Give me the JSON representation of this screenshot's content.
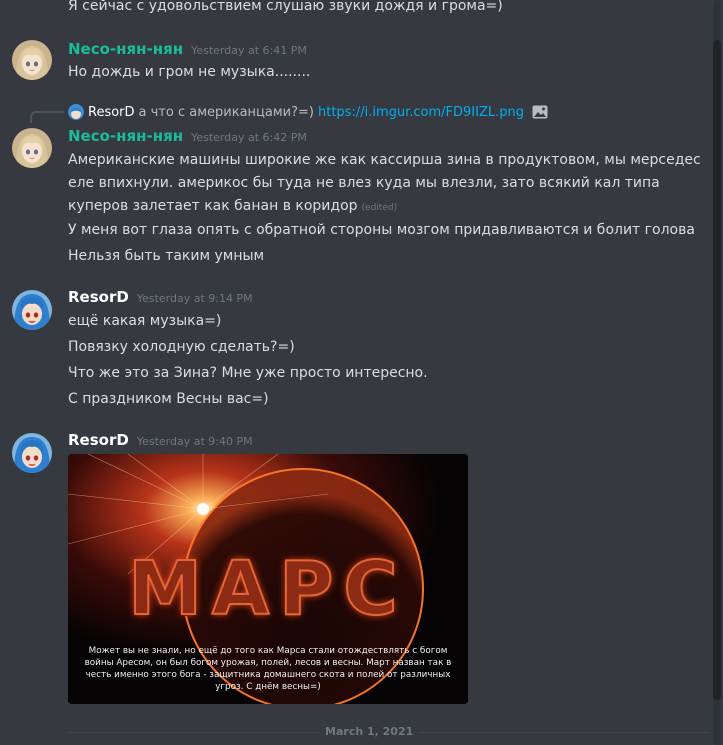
{
  "messages": {
    "m0": {
      "lines": [
        "Я сейчас с удовольствием слушаю звуки дождя и грома=)"
      ]
    },
    "m1": {
      "username": "Neco-нян-нян",
      "timestamp": "Yesterday at 6:41 PM",
      "lines": [
        "Но дождь и гром не музыка........"
      ]
    },
    "m2": {
      "reply": {
        "username": "ResorD",
        "text": "а что с американцами?=)",
        "link": "https://i.imgur.com/FD9IIZL.png"
      },
      "username": "Neco-нян-нян",
      "timestamp": "Yesterday at 6:42 PM",
      "lines": [
        "Американские машины широкие же как кассирша зина в продуктовом, мы мерседес",
        "еле впихнули. америкос бы туда не влез куда мы влезли, зато всякий кал типа",
        "куперов залетает как банан в коридор",
        "У меня вот глаза опять с обратной стороны мозгом придавливаются и болит голова",
        "Нельзя быть таким умным"
      ],
      "edited": "(edited)"
    },
    "m3": {
      "username": "ResorD",
      "timestamp": "Yesterday at 9:14 PM",
      "lines": [
        "ещё какая музыка=)",
        "Повязку холодную сделать?=)",
        "Что же это за Зина? Мне уже просто интересно.",
        "С праздником Весны вас=)"
      ]
    },
    "m4": {
      "username": "ResorD",
      "timestamp": "Yesterday at 9:40 PM",
      "image": {
        "title": "МАРС",
        "caption": "Может вы не знали, но ещё до того как Марса стали отождествлять с богом войны Аресом, он был богом урожая, полей, лесов и весны. Март назван так в честь именно этого бога - защитника домашнего скота и полей от различных угроз. С днём весны=)"
      }
    }
  },
  "divider": {
    "label": "March 1, 2021"
  },
  "colors": {
    "background": "#36393f",
    "neco_name": "#1abc9c",
    "resord_name": "#ffffff",
    "link": "#00aff4",
    "timestamp": "#72767d"
  },
  "icons": {
    "image_icon": "image-icon",
    "avatar_neco": "avatar-anime-girl",
    "avatar_resord": "avatar-anime-blue-hair"
  }
}
